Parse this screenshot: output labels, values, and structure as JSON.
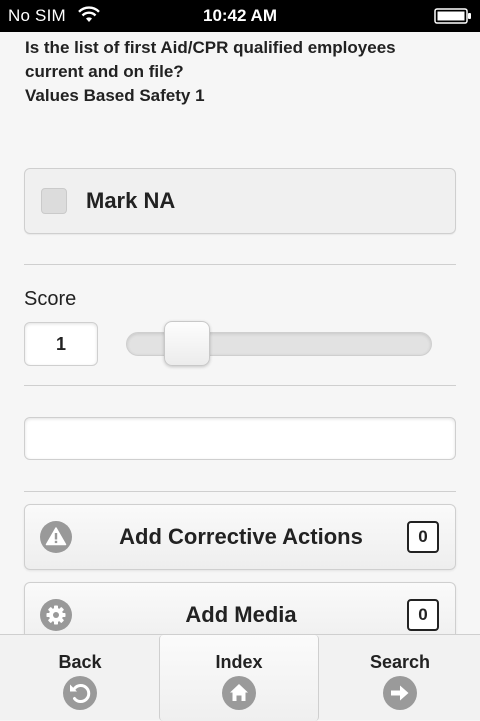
{
  "status_bar": {
    "carrier": "No SIM",
    "time": "10:42 AM",
    "wifi_icon": "wifi-icon",
    "battery_icon": "battery-icon"
  },
  "question": {
    "line1": "Is the list of first Aid/CPR qualified employees",
    "line2": "current and on file?",
    "line3": "Values Based Safety 1"
  },
  "mark_na": {
    "label": "Mark NA",
    "checked": false
  },
  "score": {
    "label": "Score",
    "value": "1",
    "slider_level": 0.15
  },
  "comment": {
    "value": "",
    "placeholder": ""
  },
  "actions": [
    {
      "label": "Add Corrective Actions",
      "count": "0",
      "icon": "warning-icon"
    },
    {
      "label": "Add Media",
      "count": "0",
      "icon": "gear-icon"
    }
  ],
  "bottom_nav": [
    {
      "label": "Back",
      "icon": "back-arrow-icon"
    },
    {
      "label": "Index",
      "icon": "home-icon"
    },
    {
      "label": "Search",
      "icon": "forward-arrow-icon"
    }
  ],
  "colors": {
    "background": "#f6f6f6",
    "icon_gray": "#999999",
    "status_bar": "#000000"
  }
}
